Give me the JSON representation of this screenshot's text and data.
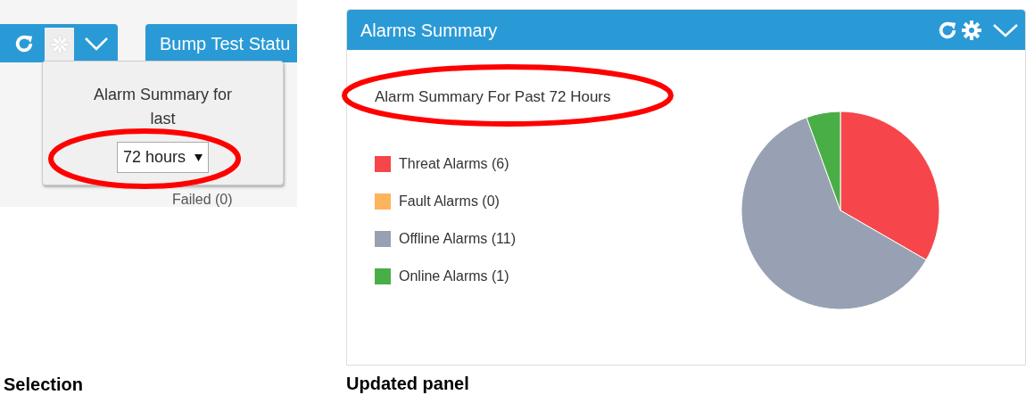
{
  "selection": {
    "header_title": "Bump Test Statu",
    "popup": {
      "label": "Alarm Summary for last",
      "dropdown": {
        "value": "72 hours"
      }
    },
    "behind_text": "Failed (0)",
    "caption": "Selection"
  },
  "updated_panel": {
    "title": "Alarms Summary",
    "subtitle": "Alarm Summary For Past 72 Hours",
    "legend": [
      {
        "label": "Threat Alarms (6)",
        "color": "#f6464b"
      },
      {
        "label": "Fault Alarms (0)",
        "color": "#fdb45c"
      },
      {
        "label": "Offline Alarms (11)",
        "color": "#97a1b3"
      },
      {
        "label": "Online Alarms (1)",
        "color": "#4aae46"
      }
    ],
    "chart_data": {
      "type": "pie",
      "series": [
        {
          "values": [
            33.33,
            0,
            61.11,
            5.56
          ]
        }
      ]
    },
    "caption": "Updated panel"
  }
}
